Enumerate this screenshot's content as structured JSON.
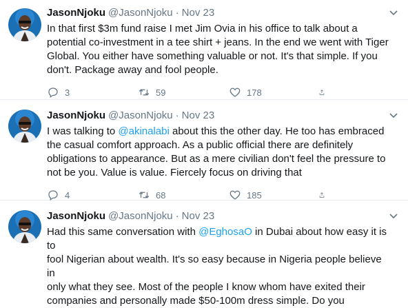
{
  "tweets": [
    {
      "name": "JasonNjoku",
      "handle": "@JasonNjoku",
      "separator": "·",
      "time": "Nov 23",
      "text_parts": [
        {
          "t": "In that first $3m fund raise I met Jim Ovia in his office to talk about a\npotential co-investment in a tee shirt + jeans. In the end we went with Tiger\nGlobal. You either have something valuable or not. It's that simple. If you\ndon't. Package away and fool people.",
          "mention": false
        }
      ],
      "replies": "3",
      "retweets": "59",
      "likes": "178"
    },
    {
      "name": "JasonNjoku",
      "handle": "@JasonNjoku",
      "separator": "·",
      "time": "Nov 23",
      "text_parts": [
        {
          "t": "I was talking to ",
          "mention": false
        },
        {
          "t": "@akinalabi",
          "mention": true
        },
        {
          "t": " about this the other day. He too has embraced\nthe casual comfort approach. As a public official there are definitely\nobligations to appearance. But as a mere civilian don't feel the pressure to\nnot be you. Value is value. Fiercely focus on driving that",
          "mention": false
        }
      ],
      "replies": "4",
      "retweets": "68",
      "likes": "185"
    },
    {
      "name": "JasonNjoku",
      "handle": "@JasonNjoku",
      "separator": "·",
      "time": "Nov 23",
      "text_parts": [
        {
          "t": "Had this same conversation with ",
          "mention": false
        },
        {
          "t": "@EghosaO",
          "mention": true
        },
        {
          "t": " in Dubai about how easy it is to\nfool Nigerian about wealth. It's so easy because in Nigeria people believe in\nonly what they see. Most of the people I know whom have exited their\ncompanies and personally made $50-100m dress simple. Do you",
          "mention": false
        }
      ]
    }
  ],
  "colors": {
    "text": "#14171a",
    "muted": "#657786",
    "link": "#1da1f2",
    "divider": "#e6ecf0",
    "avatar_bg": "#1a6fb5"
  },
  "icons": {
    "reply": "reply-icon",
    "retweet": "retweet-icon",
    "like": "like-icon",
    "share": "share-icon",
    "caret": "chevron-down-icon"
  }
}
